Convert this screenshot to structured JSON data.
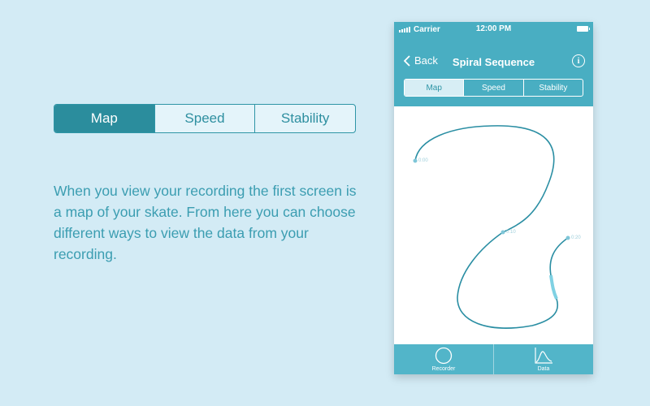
{
  "big_segment": {
    "items": [
      "Map",
      "Speed",
      "Stability"
    ],
    "active": "Map"
  },
  "description": "When you view your recording the first screen is a map of your skate. From here you can choose different ways to view the data from your recording.",
  "phone": {
    "status_bar": {
      "carrier": "Carrier",
      "time": "12:00 PM"
    },
    "nav": {
      "back_label": "Back",
      "title": "Spiral Sequence",
      "info_label": "i"
    },
    "segment": {
      "items": [
        "Map",
        "Speed",
        "Stability"
      ],
      "active": "Map"
    },
    "map": {
      "waypoints": [
        "0:00",
        "0:10",
        "0:20"
      ],
      "path_color": "#2a8ea3",
      "highlight_color": "#7fd1e3"
    },
    "tabbar": {
      "recorder_label": "Recorder",
      "data_label": "Data"
    }
  },
  "colors": {
    "background": "#d3ebf5",
    "accent": "#2b8d9d",
    "phone_header": "#49aec2",
    "tabbar": "#52b5c9"
  }
}
